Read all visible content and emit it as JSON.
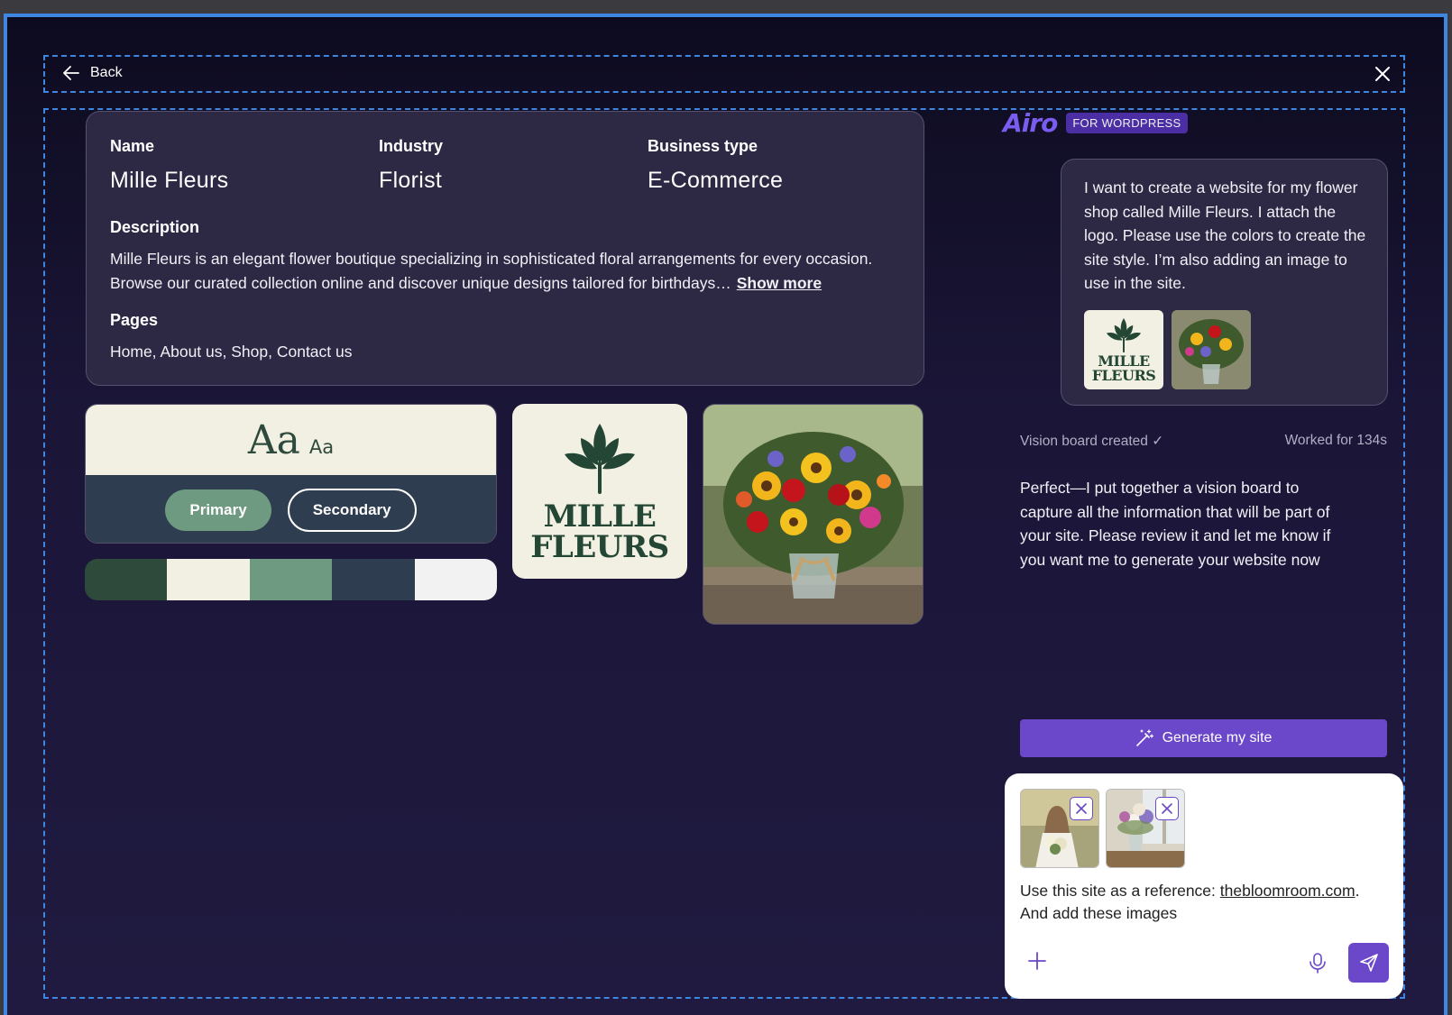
{
  "nav": {
    "back_label": "Back"
  },
  "business": {
    "name_label": "Name",
    "name_value": "Mille Fleurs",
    "industry_label": "Industry",
    "industry_value": "Florist",
    "type_label": "Business type",
    "type_value": "E-Commerce",
    "description_label": "Description",
    "description_value": "Mille Fleurs is an elegant flower boutique specializing in sophisticated floral arrangements for every occasion. Browse our curated collection online and discover unique designs tailored for birthdays…",
    "show_more": "Show more",
    "pages_label": "Pages",
    "pages_value": "Home, About us, Shop, Contact us"
  },
  "typography": {
    "sample_large": "Aa",
    "sample_small": "Aa",
    "primary_button": "Primary",
    "secondary_button": "Secondary"
  },
  "palette": [
    "#2e4a3a",
    "#f2efe3",
    "#6d9a80",
    "#2e3d4f",
    "#f1f2f1"
  ],
  "logo": {
    "line1": "MILLE",
    "line2": "FLEURS",
    "color": "#234734"
  },
  "brand": {
    "name": "Airo",
    "badge": "FOR WORDPRESS",
    "accent": "#6b47c9"
  },
  "chat": {
    "user_message": "I want to create a website for my flower shop called Mille Fleurs. I attach the logo. Please use the colors to create the site style. I’m also adding an image to use in the site.",
    "status": "Vision board created ✓",
    "worked": "Worked for 134s",
    "assistant_message": "Perfect—I put together a vision board to capture all the information that will be part of your site. Please review it and let me know if you want me to generate your website now",
    "generate_button": "Generate my site"
  },
  "composer": {
    "text_before": "Use this site as a reference: ",
    "link": "thebloomroom.com",
    "text_after": ". And add these images"
  }
}
